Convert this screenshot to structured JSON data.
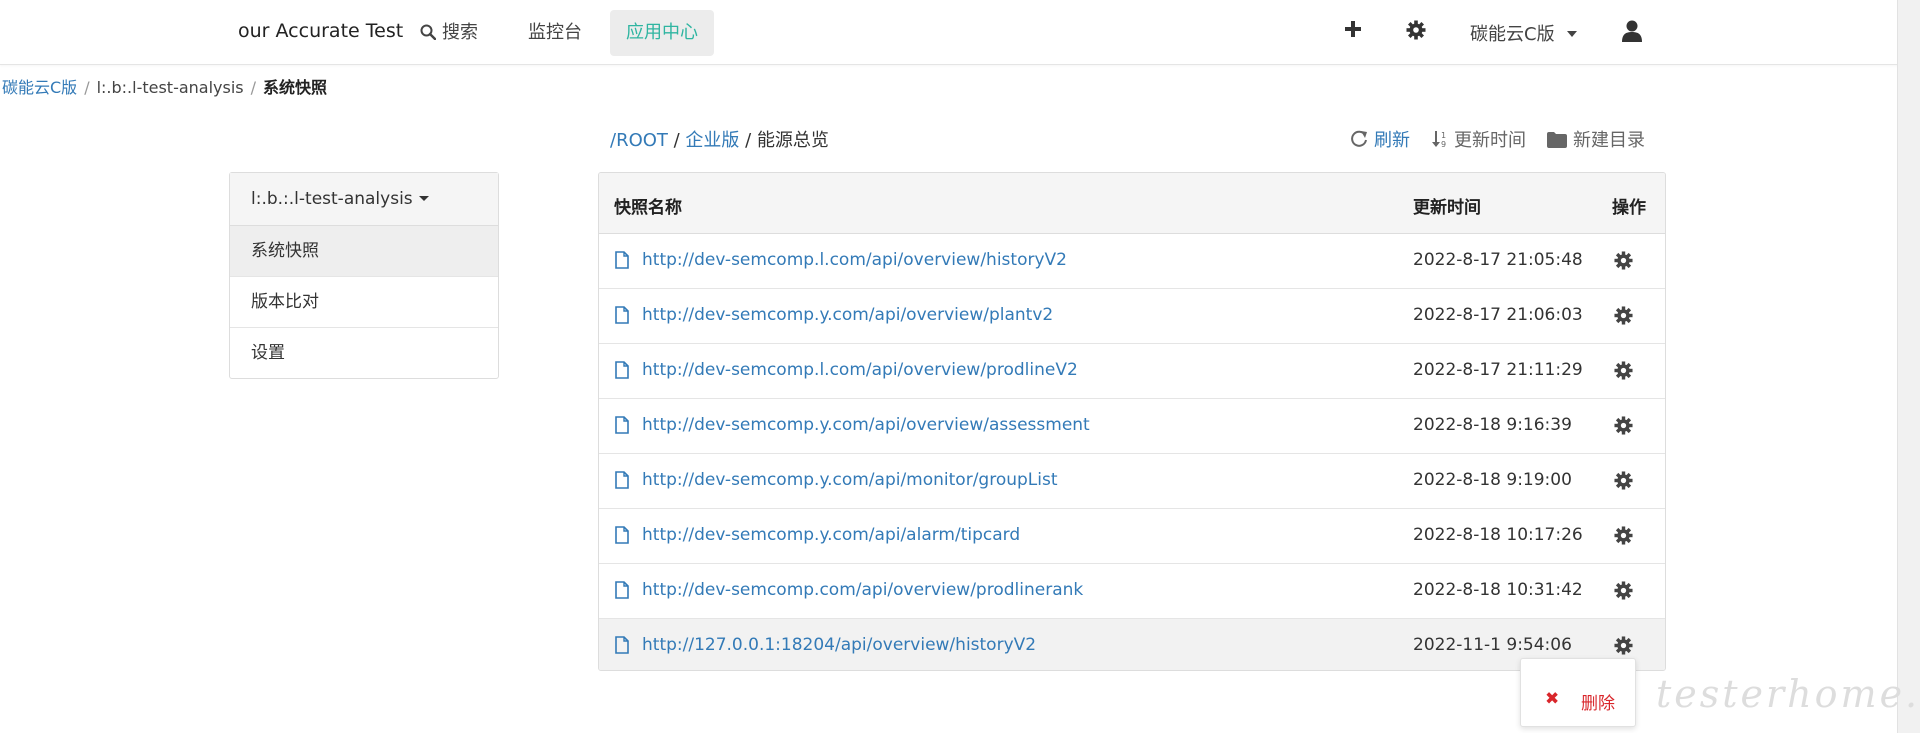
{
  "navbar": {
    "brand": "our Accurate Test",
    "search_label": "搜索",
    "monitor_label": "监控台",
    "app_center_label": "应用中心",
    "version_label": "碳能云C版"
  },
  "breadcrumb": {
    "root": "碳能云C版",
    "project": "l:.b:.l-test-analysis",
    "current": "系统快照"
  },
  "sidebar": {
    "project_name": "l:.b.:.l-test-analysis",
    "items": [
      {
        "label": "系统快照"
      },
      {
        "label": "版本比对"
      },
      {
        "label": "设置"
      }
    ]
  },
  "path": {
    "root": "/ROOT",
    "sep1": " / ",
    "enterprise": "企业版",
    "sep2": " / ",
    "current": "能源总览"
  },
  "toolbar": {
    "refresh_label": "刷新",
    "update_time_label": "更新时间",
    "new_dir_label": "新建目录"
  },
  "table": {
    "columns": [
      "快照名称",
      "更新时间",
      "操作"
    ],
    "rows": [
      {
        "url": "http://dev-semcomp.l.com/api/overview/historyV2",
        "time": "2022-8-17 21:05:48"
      },
      {
        "url": "http://dev-semcomp.y.com/api/overview/plantv2",
        "time": "2022-8-17 21:06:03"
      },
      {
        "url": "http://dev-semcomp.l.com/api/overview/prodlineV2",
        "time": "2022-8-17 21:11:29"
      },
      {
        "url": "http://dev-semcomp.y.com/api/overview/assessment",
        "time": "2022-8-18 9:16:39"
      },
      {
        "url": "http://dev-semcomp.y.com/api/monitor/groupList",
        "time": "2022-8-18 9:19:00"
      },
      {
        "url": "http://dev-semcomp.y.com/api/alarm/tipcard",
        "time": "2022-8-18 10:17:26"
      },
      {
        "url": "http://dev-semcomp.com/api/overview/prodlinerank",
        "time": "2022-8-18 10:31:42"
      },
      {
        "url": "http://127.0.0.1:18204/api/overview/historyV2",
        "time": "2022-11-1 9:54:06"
      }
    ]
  },
  "popover": {
    "delete_icon": "✖",
    "delete_label": "删除"
  },
  "watermark": "testerhome.com",
  "colors": {
    "link": "#337ab7",
    "accent": "#2fb5a1",
    "danger": "#d9262b"
  }
}
